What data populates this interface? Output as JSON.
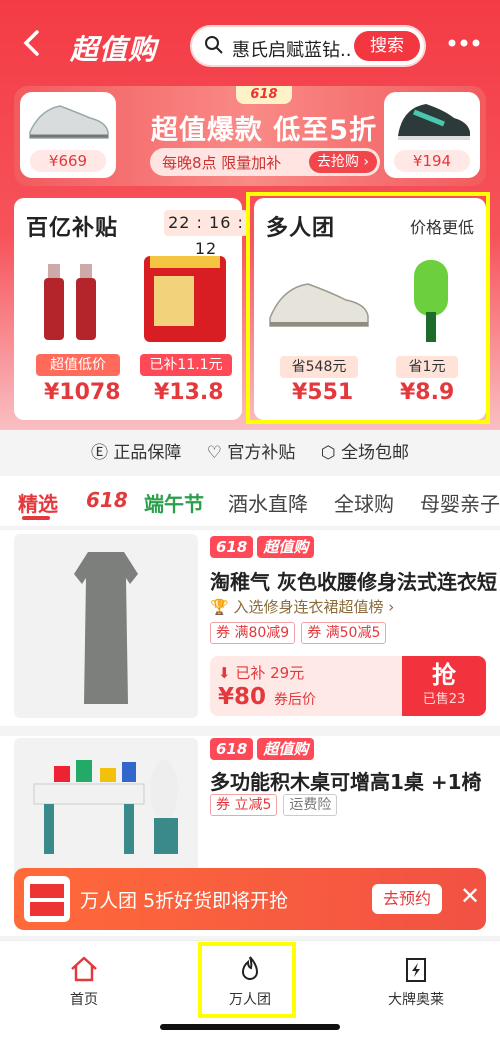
{
  "header": {
    "back_icon": "back-arrow-icon",
    "logo": "超值购",
    "search_text": "惠氏启赋蓝钻...",
    "search_button": "搜索",
    "more_icon": "more-dots-icon"
  },
  "banner": {
    "badge": "618",
    "title": "超值爆款 低至5折",
    "subtitle": "每晚8点 限量加补",
    "cta": "去抢购 ›",
    "left_price": "¥669",
    "right_price": "¥194"
  },
  "subsidy_card": {
    "title": "百亿补贴",
    "timer": "22 : 16 : 12",
    "products": [
      {
        "tag": "超值低价",
        "price": "¥1078"
      },
      {
        "tag": "已补11.1元",
        "price": "¥13.8"
      }
    ]
  },
  "group_card": {
    "title": "多人团",
    "subtitle": "价格更低",
    "products": [
      {
        "tag": "省548元",
        "price": "¥551"
      },
      {
        "tag": "省1元",
        "price": "¥8.9"
      }
    ]
  },
  "promises": [
    "正品保障",
    "官方补贴",
    "全场包邮"
  ],
  "tabs": [
    "精选",
    "618",
    "端午节",
    "酒水直降",
    "全球购",
    "母婴亲子"
  ],
  "items": [
    {
      "badges": [
        "618",
        "超值购"
      ],
      "brand": "淘稚气",
      "title": "灰色收腰修身法式连衣短",
      "rank": "入选修身连衣裙超值榜 ›",
      "coupons": [
        "满80减9",
        "满50减5"
      ],
      "coupon_prefix": "券",
      "subsidy": "已补 29元",
      "after_price": "¥80",
      "after_label": "券后价",
      "grab": "抢",
      "sold": "已售23"
    },
    {
      "badges": [
        "618",
        "超值购"
      ],
      "title": "多功能积木桌可增高1桌 +1椅",
      "coupons": [
        "立减5"
      ],
      "coupon_prefix": "券",
      "insurance": "运费险"
    }
  ],
  "float_bar": {
    "text": "万人团  5折好货即将开抢",
    "button": "去预约"
  },
  "nav": [
    {
      "label": "首页",
      "icon": "home-icon"
    },
    {
      "label": "万人团",
      "icon": "flame-icon"
    },
    {
      "label": "大牌奥莱",
      "icon": "bolt-bag-icon"
    }
  ],
  "colors": {
    "brand": "#e4393c",
    "highlight": "#ffff00"
  }
}
